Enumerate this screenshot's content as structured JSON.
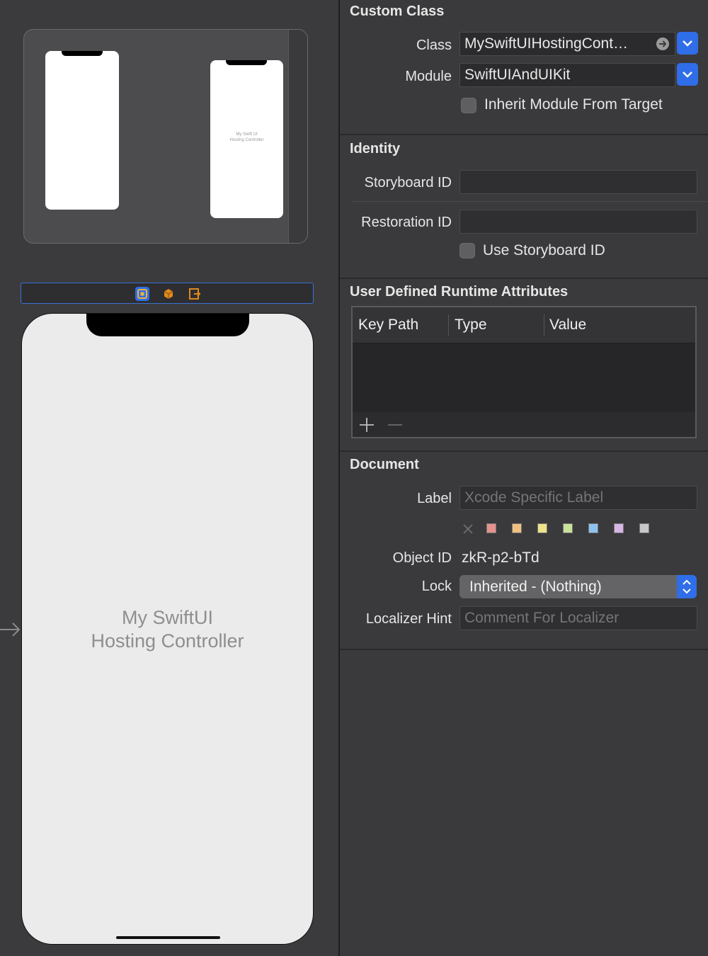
{
  "canvas": {
    "minimap": {
      "scene_text_line1": "My Swift UI",
      "scene_text_line2": "Hosting Controller"
    },
    "scene_title_line1": "My SwiftUI",
    "scene_title_line2": "Hosting Controller"
  },
  "inspector": {
    "custom_class": {
      "title": "Custom Class",
      "class_label": "Class",
      "class_value": "MySwiftUIHostingCont…",
      "module_label": "Module",
      "module_value": "SwiftUIAndUIKit",
      "inherit_label": "Inherit Module From Target"
    },
    "identity": {
      "title": "Identity",
      "storyboard_id_label": "Storyboard ID",
      "storyboard_id_value": "",
      "restoration_id_label": "Restoration ID",
      "restoration_id_value": "",
      "use_storyboard_id_label": "Use Storyboard ID"
    },
    "runtime_attributes": {
      "title": "User Defined Runtime Attributes",
      "columns": [
        "Key Path",
        "Type",
        "Value"
      ]
    },
    "document": {
      "title": "Document",
      "label_label": "Label",
      "label_placeholder": "Xcode Specific Label",
      "swatches": [
        "#e5928f",
        "#efc07f",
        "#efe08a",
        "#c9e39a",
        "#8fc3ef",
        "#d9b4e6",
        "#c8c8c8"
      ],
      "object_id_label": "Object ID",
      "object_id_value": "zkR-p2-bTd",
      "lock_label": "Lock",
      "lock_value": "Inherited - (Nothing)",
      "localizer_hint_label": "Localizer Hint",
      "localizer_hint_placeholder": "Comment For Localizer"
    }
  },
  "colors": {
    "accent": "#2f6ee8",
    "canvas_bg": "#3b3b3d",
    "inspector_bg": "#3a3a3c"
  }
}
